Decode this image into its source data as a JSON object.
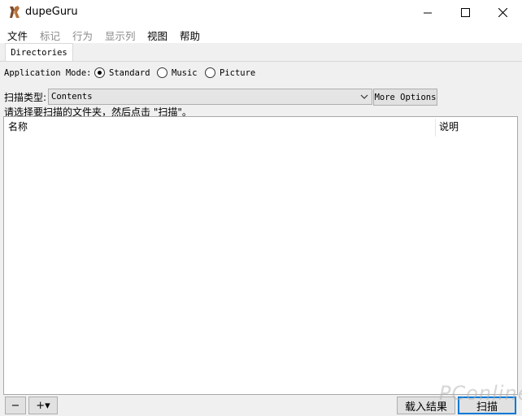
{
  "window": {
    "title": "dupeGuru",
    "minimize_icon": "minimize-icon",
    "maximize_icon": "maximize-icon",
    "close_icon": "close-icon"
  },
  "menu": {
    "items": [
      {
        "label": "文件",
        "enabled": true
      },
      {
        "label": "标记",
        "enabled": false
      },
      {
        "label": "行为",
        "enabled": false
      },
      {
        "label": "显示列",
        "enabled": false
      },
      {
        "label": "视图",
        "enabled": true
      },
      {
        "label": "帮助",
        "enabled": true
      }
    ]
  },
  "tabs": [
    {
      "label": "Directories",
      "active": true
    }
  ],
  "app_mode": {
    "label": "Application Mode:",
    "options": [
      {
        "label": "Standard",
        "checked": true
      },
      {
        "label": "Music",
        "checked": false
      },
      {
        "label": "Picture",
        "checked": false
      }
    ]
  },
  "scan_type": {
    "label": "扫描类型:",
    "selected": "Contents",
    "more_options_label": "More Options"
  },
  "hint": "请选择要扫描的文件夹，然后点击 \"扫描\"。",
  "table": {
    "columns": [
      "名称",
      "说明"
    ],
    "rows": []
  },
  "bottom": {
    "remove_label": "−",
    "add_label": "+▾",
    "load_results_label": "载入结果",
    "scan_label": "扫描"
  },
  "watermark": "PConline",
  "colors": {
    "focus_border": "#0078d7",
    "disabled_text": "#8a8a8a"
  }
}
